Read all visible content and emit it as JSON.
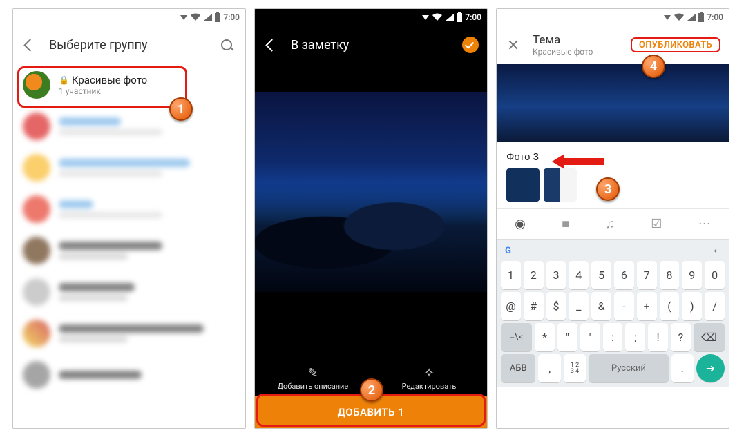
{
  "status": {
    "time": "7:00"
  },
  "screen1": {
    "title": "Выберите группу",
    "group_name": "Красивые фото",
    "group_members": "1 участник"
  },
  "screen2": {
    "title": "В заметку",
    "action_left": "Добавить описание",
    "action_right": "Редактировать",
    "add_button": "ДОБАВИТЬ 1"
  },
  "screen3": {
    "title": "Тема",
    "subtitle": "Красивые фото",
    "publish": "ОПУБЛИКОВАТЬ",
    "caption": "Фото 3",
    "lang_switch": "АБВ",
    "spacebar": "Русский",
    "num_key": "1 2\n3 4"
  },
  "kb_rows": {
    "r1": [
      "1",
      "2",
      "3",
      "4",
      "5",
      "6",
      "7",
      "8",
      "9",
      "0"
    ],
    "r2": [
      "@",
      "#",
      "$",
      "_",
      "&",
      "-",
      "+",
      "(",
      ")",
      "/"
    ],
    "r3": [
      "*",
      "\"",
      "'",
      ":",
      ";",
      "!",
      "?"
    ]
  },
  "badges": {
    "s1": "1",
    "s2": "2",
    "s3": "3",
    "s4": "4"
  }
}
